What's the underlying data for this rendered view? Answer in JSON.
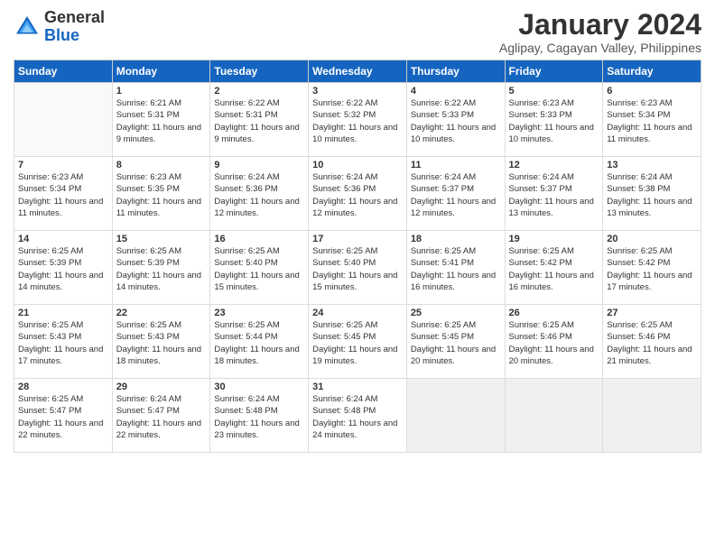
{
  "header": {
    "logo_general": "General",
    "logo_blue": "Blue",
    "month_title": "January 2024",
    "subtitle": "Aglipay, Cagayan Valley, Philippines"
  },
  "days_of_week": [
    "Sunday",
    "Monday",
    "Tuesday",
    "Wednesday",
    "Thursday",
    "Friday",
    "Saturday"
  ],
  "weeks": [
    [
      {
        "day": "",
        "sunrise": "",
        "sunset": "",
        "daylight": "",
        "empty": true
      },
      {
        "day": "1",
        "sunrise": "Sunrise: 6:21 AM",
        "sunset": "Sunset: 5:31 PM",
        "daylight": "Daylight: 11 hours and 9 minutes."
      },
      {
        "day": "2",
        "sunrise": "Sunrise: 6:22 AM",
        "sunset": "Sunset: 5:31 PM",
        "daylight": "Daylight: 11 hours and 9 minutes."
      },
      {
        "day": "3",
        "sunrise": "Sunrise: 6:22 AM",
        "sunset": "Sunset: 5:32 PM",
        "daylight": "Daylight: 11 hours and 10 minutes."
      },
      {
        "day": "4",
        "sunrise": "Sunrise: 6:22 AM",
        "sunset": "Sunset: 5:33 PM",
        "daylight": "Daylight: 11 hours and 10 minutes."
      },
      {
        "day": "5",
        "sunrise": "Sunrise: 6:23 AM",
        "sunset": "Sunset: 5:33 PM",
        "daylight": "Daylight: 11 hours and 10 minutes."
      },
      {
        "day": "6",
        "sunrise": "Sunrise: 6:23 AM",
        "sunset": "Sunset: 5:34 PM",
        "daylight": "Daylight: 11 hours and 11 minutes."
      }
    ],
    [
      {
        "day": "7",
        "sunrise": "Sunrise: 6:23 AM",
        "sunset": "Sunset: 5:34 PM",
        "daylight": "Daylight: 11 hours and 11 minutes."
      },
      {
        "day": "8",
        "sunrise": "Sunrise: 6:23 AM",
        "sunset": "Sunset: 5:35 PM",
        "daylight": "Daylight: 11 hours and 11 minutes."
      },
      {
        "day": "9",
        "sunrise": "Sunrise: 6:24 AM",
        "sunset": "Sunset: 5:36 PM",
        "daylight": "Daylight: 11 hours and 12 minutes."
      },
      {
        "day": "10",
        "sunrise": "Sunrise: 6:24 AM",
        "sunset": "Sunset: 5:36 PM",
        "daylight": "Daylight: 11 hours and 12 minutes."
      },
      {
        "day": "11",
        "sunrise": "Sunrise: 6:24 AM",
        "sunset": "Sunset: 5:37 PM",
        "daylight": "Daylight: 11 hours and 12 minutes."
      },
      {
        "day": "12",
        "sunrise": "Sunrise: 6:24 AM",
        "sunset": "Sunset: 5:37 PM",
        "daylight": "Daylight: 11 hours and 13 minutes."
      },
      {
        "day": "13",
        "sunrise": "Sunrise: 6:24 AM",
        "sunset": "Sunset: 5:38 PM",
        "daylight": "Daylight: 11 hours and 13 minutes."
      }
    ],
    [
      {
        "day": "14",
        "sunrise": "Sunrise: 6:25 AM",
        "sunset": "Sunset: 5:39 PM",
        "daylight": "Daylight: 11 hours and 14 minutes."
      },
      {
        "day": "15",
        "sunrise": "Sunrise: 6:25 AM",
        "sunset": "Sunset: 5:39 PM",
        "daylight": "Daylight: 11 hours and 14 minutes."
      },
      {
        "day": "16",
        "sunrise": "Sunrise: 6:25 AM",
        "sunset": "Sunset: 5:40 PM",
        "daylight": "Daylight: 11 hours and 15 minutes."
      },
      {
        "day": "17",
        "sunrise": "Sunrise: 6:25 AM",
        "sunset": "Sunset: 5:40 PM",
        "daylight": "Daylight: 11 hours and 15 minutes."
      },
      {
        "day": "18",
        "sunrise": "Sunrise: 6:25 AM",
        "sunset": "Sunset: 5:41 PM",
        "daylight": "Daylight: 11 hours and 16 minutes."
      },
      {
        "day": "19",
        "sunrise": "Sunrise: 6:25 AM",
        "sunset": "Sunset: 5:42 PM",
        "daylight": "Daylight: 11 hours and 16 minutes."
      },
      {
        "day": "20",
        "sunrise": "Sunrise: 6:25 AM",
        "sunset": "Sunset: 5:42 PM",
        "daylight": "Daylight: 11 hours and 17 minutes."
      }
    ],
    [
      {
        "day": "21",
        "sunrise": "Sunrise: 6:25 AM",
        "sunset": "Sunset: 5:43 PM",
        "daylight": "Daylight: 11 hours and 17 minutes."
      },
      {
        "day": "22",
        "sunrise": "Sunrise: 6:25 AM",
        "sunset": "Sunset: 5:43 PM",
        "daylight": "Daylight: 11 hours and 18 minutes."
      },
      {
        "day": "23",
        "sunrise": "Sunrise: 6:25 AM",
        "sunset": "Sunset: 5:44 PM",
        "daylight": "Daylight: 11 hours and 18 minutes."
      },
      {
        "day": "24",
        "sunrise": "Sunrise: 6:25 AM",
        "sunset": "Sunset: 5:45 PM",
        "daylight": "Daylight: 11 hours and 19 minutes."
      },
      {
        "day": "25",
        "sunrise": "Sunrise: 6:25 AM",
        "sunset": "Sunset: 5:45 PM",
        "daylight": "Daylight: 11 hours and 20 minutes."
      },
      {
        "day": "26",
        "sunrise": "Sunrise: 6:25 AM",
        "sunset": "Sunset: 5:46 PM",
        "daylight": "Daylight: 11 hours and 20 minutes."
      },
      {
        "day": "27",
        "sunrise": "Sunrise: 6:25 AM",
        "sunset": "Sunset: 5:46 PM",
        "daylight": "Daylight: 11 hours and 21 minutes."
      }
    ],
    [
      {
        "day": "28",
        "sunrise": "Sunrise: 6:25 AM",
        "sunset": "Sunset: 5:47 PM",
        "daylight": "Daylight: 11 hours and 22 minutes."
      },
      {
        "day": "29",
        "sunrise": "Sunrise: 6:24 AM",
        "sunset": "Sunset: 5:47 PM",
        "daylight": "Daylight: 11 hours and 22 minutes."
      },
      {
        "day": "30",
        "sunrise": "Sunrise: 6:24 AM",
        "sunset": "Sunset: 5:48 PM",
        "daylight": "Daylight: 11 hours and 23 minutes."
      },
      {
        "day": "31",
        "sunrise": "Sunrise: 6:24 AM",
        "sunset": "Sunset: 5:48 PM",
        "daylight": "Daylight: 11 hours and 24 minutes."
      },
      {
        "day": "",
        "sunrise": "",
        "sunset": "",
        "daylight": "",
        "empty": true
      },
      {
        "day": "",
        "sunrise": "",
        "sunset": "",
        "daylight": "",
        "empty": true
      },
      {
        "day": "",
        "sunrise": "",
        "sunset": "",
        "daylight": "",
        "empty": true
      }
    ]
  ]
}
